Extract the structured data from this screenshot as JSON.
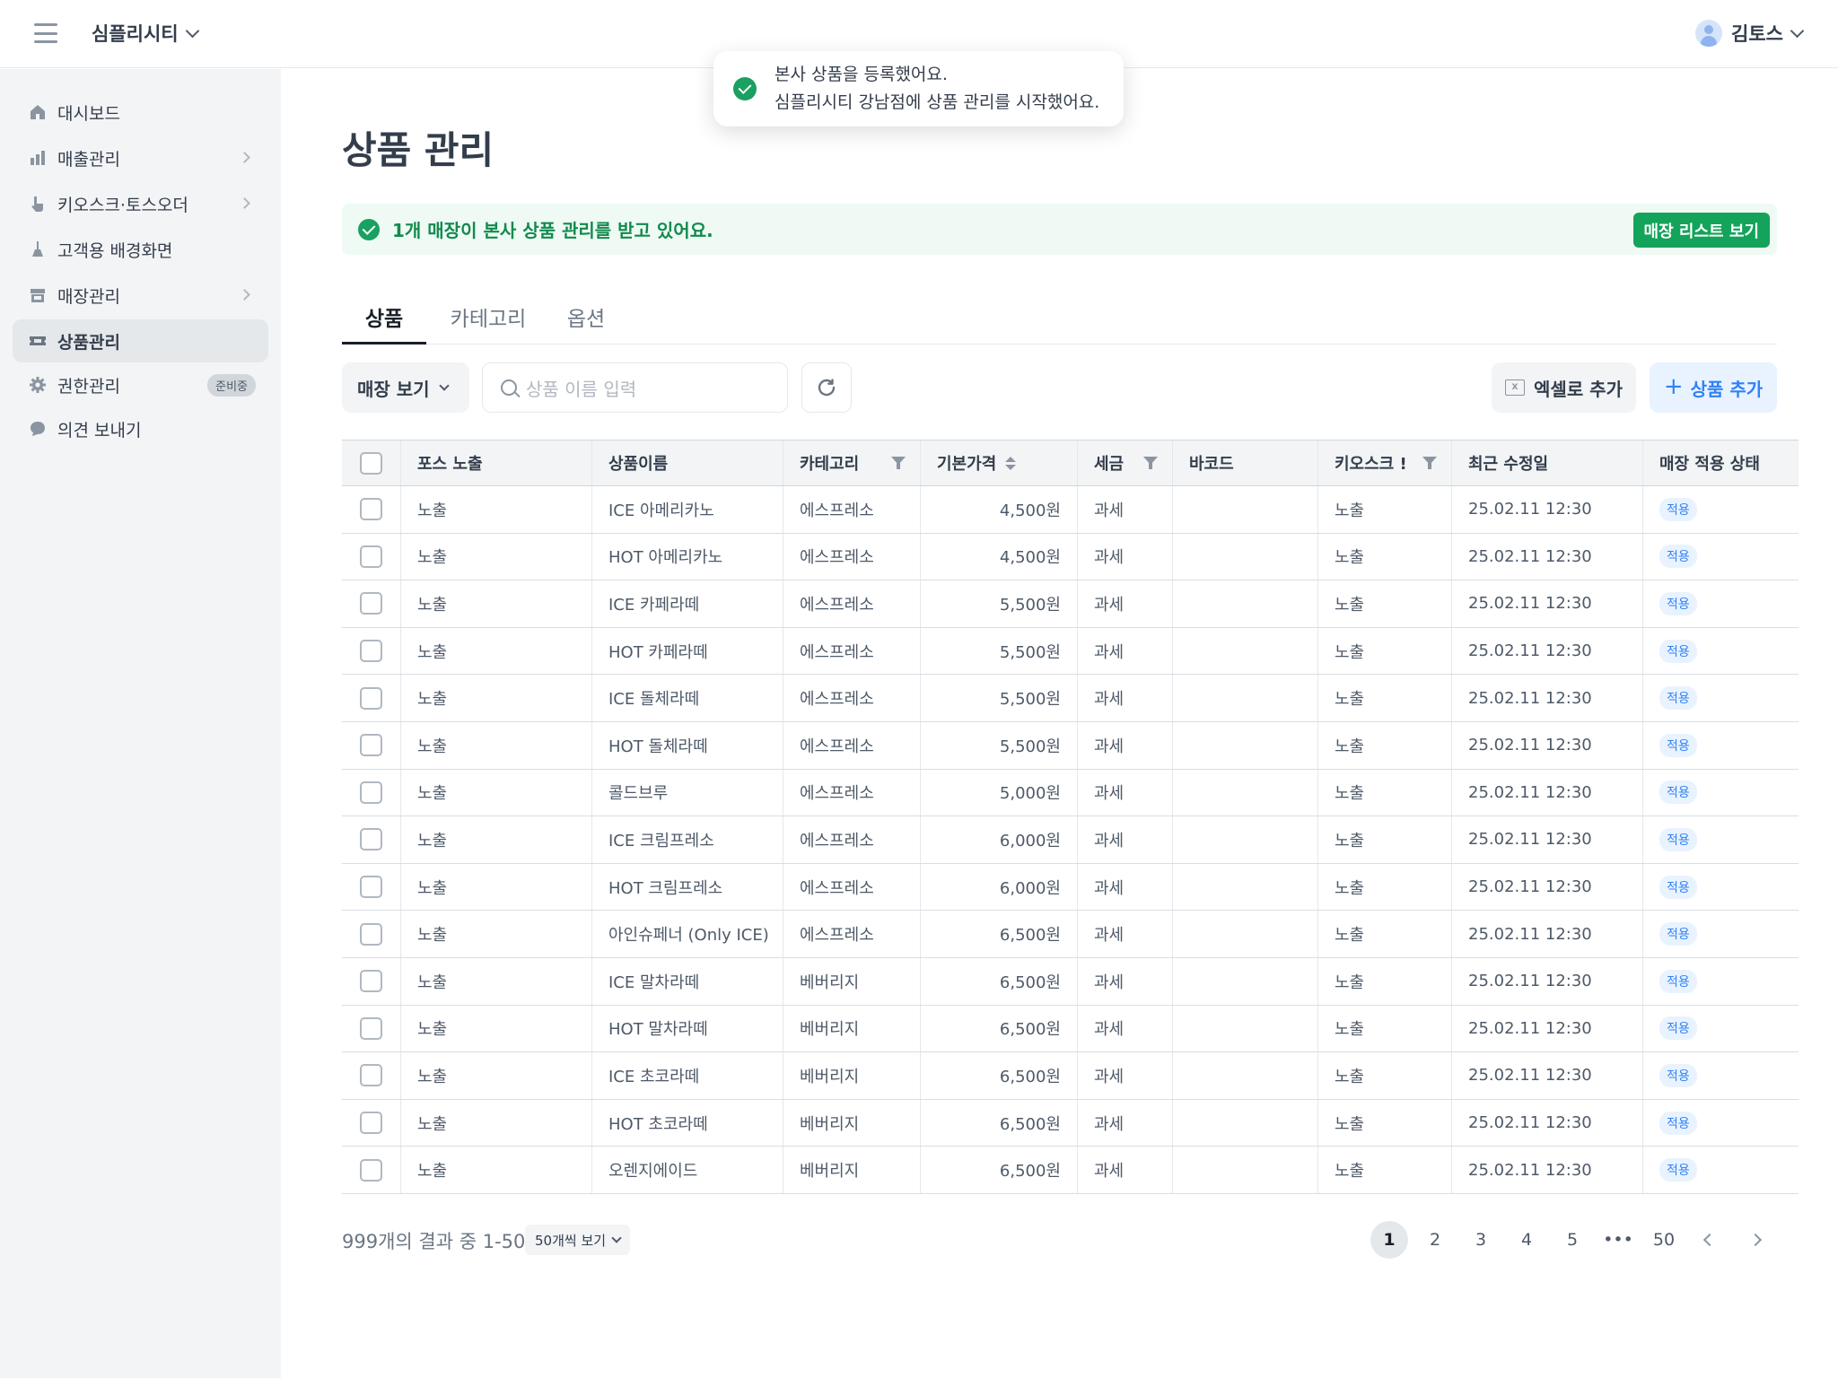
{
  "header": {
    "org_name": "심플리시티",
    "user_name": "김토스"
  },
  "sidebar": {
    "items": [
      {
        "label": "대시보드",
        "icon": "home-icon",
        "arrow": false
      },
      {
        "label": "매출관리",
        "icon": "bar-chart-icon",
        "arrow": true
      },
      {
        "label": "키오스크·토스오더",
        "icon": "pointer-hand-icon",
        "arrow": true
      },
      {
        "label": "고객용 배경화면",
        "icon": "brush-icon",
        "arrow": false
      },
      {
        "label": "매장관리",
        "icon": "store-icon",
        "arrow": true
      },
      {
        "label": "상품관리",
        "icon": "ticket-icon",
        "arrow": false,
        "active": true
      },
      {
        "label": "권한관리",
        "icon": "gear-icon",
        "arrow": false,
        "badge": "준비중"
      },
      {
        "label": "의견 보내기",
        "icon": "chat-bubble-icon",
        "arrow": false
      }
    ]
  },
  "toast": {
    "line1": "본사 상품을 등록했어요.",
    "line2": "심플리시티 강남점에 상품 관리를 시작했어요."
  },
  "page": {
    "title": "상품 관리"
  },
  "banner": {
    "text": "1개 매장이 본사 상품 관리를 받고 있어요.",
    "button": "매장 리스트 보기"
  },
  "tabs": [
    "상품",
    "카테고리",
    "옵션"
  ],
  "toolbar": {
    "store_view": "매장 보기",
    "search_placeholder": "상품 이름 입력",
    "excel_button": "엑셀로 추가",
    "add_button": "상품 추가"
  },
  "table": {
    "columns": [
      "포스 노출",
      "상품이름",
      "카테고리",
      "기본가격",
      "세금",
      "바코드",
      "키오스크 !",
      "최근 수정일",
      "매장 적용 상태"
    ],
    "rows": [
      [
        "노출",
        "ICE 아메리카노",
        "에스프레소",
        "4,500원",
        "과세",
        "",
        "노출",
        "25.02.11 12:30",
        "적용"
      ],
      [
        "노출",
        "HOT 아메리카노",
        "에스프레소",
        "4,500원",
        "과세",
        "",
        "노출",
        "25.02.11 12:30",
        "적용"
      ],
      [
        "노출",
        "ICE 카페라떼",
        "에스프레소",
        "5,500원",
        "과세",
        "",
        "노출",
        "25.02.11 12:30",
        "적용"
      ],
      [
        "노출",
        "HOT 카페라떼",
        "에스프레소",
        "5,500원",
        "과세",
        "",
        "노출",
        "25.02.11 12:30",
        "적용"
      ],
      [
        "노출",
        "ICE 돌체라떼",
        "에스프레소",
        "5,500원",
        "과세",
        "",
        "노출",
        "25.02.11 12:30",
        "적용"
      ],
      [
        "노출",
        "HOT 돌체라떼",
        "에스프레소",
        "5,500원",
        "과세",
        "",
        "노출",
        "25.02.11 12:30",
        "적용"
      ],
      [
        "노출",
        "콜드브루",
        "에스프레소",
        "5,000원",
        "과세",
        "",
        "노출",
        "25.02.11 12:30",
        "적용"
      ],
      [
        "노출",
        "ICE 크림프레소",
        "에스프레소",
        "6,000원",
        "과세",
        "",
        "노출",
        "25.02.11 12:30",
        "적용"
      ],
      [
        "노출",
        "HOT 크림프레소",
        "에스프레소",
        "6,000원",
        "과세",
        "",
        "노출",
        "25.02.11 12:30",
        "적용"
      ],
      [
        "노출",
        "아인슈페너 (Only ICE)",
        "에스프레소",
        "6,500원",
        "과세",
        "",
        "노출",
        "25.02.11 12:30",
        "적용"
      ],
      [
        "노출",
        "ICE 말차라떼",
        "베버리지",
        "6,500원",
        "과세",
        "",
        "노출",
        "25.02.11 12:30",
        "적용"
      ],
      [
        "노출",
        "HOT 말차라떼",
        "베버리지",
        "6,500원",
        "과세",
        "",
        "노출",
        "25.02.11 12:30",
        "적용"
      ],
      [
        "노출",
        "ICE 초코라떼",
        "베버리지",
        "6,500원",
        "과세",
        "",
        "노출",
        "25.02.11 12:30",
        "적용"
      ],
      [
        "노출",
        "HOT 초코라떼",
        "베버리지",
        "6,500원",
        "과세",
        "",
        "노출",
        "25.02.11 12:30",
        "적용"
      ],
      [
        "노출",
        "오렌지에이드",
        "베버리지",
        "6,500원",
        "과세",
        "",
        "노출",
        "25.02.11 12:30",
        "적용"
      ]
    ]
  },
  "footer": {
    "result_count": "999개의 결과 중 1-50",
    "page_size": "50개씩 보기",
    "pages": [
      "1",
      "2",
      "3",
      "4",
      "5",
      "•••",
      "50"
    ],
    "current_page": "1"
  },
  "colors": {
    "accent_green": "#14a35a",
    "accent_blue": "#3182f6",
    "sidebar_bg": "#f3f4f6"
  }
}
